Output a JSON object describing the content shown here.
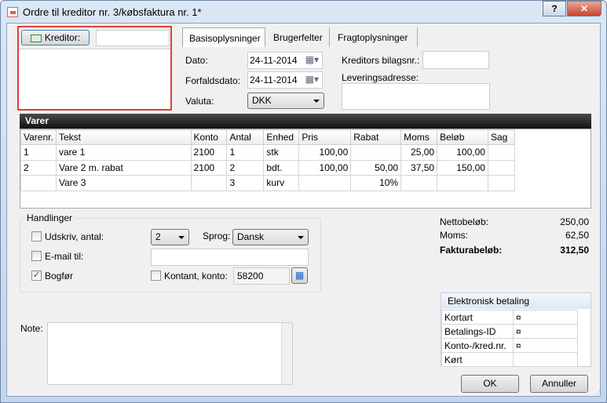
{
  "window": {
    "title": "Ordre til kreditor nr. 3/købsfaktura nr. 1*",
    "help": "?",
    "close": "✕"
  },
  "creditor": {
    "button": "Kreditor:",
    "value": ""
  },
  "tabs": [
    "Basisoplysninger",
    "Brugerfelter",
    "Fragtoplysninger"
  ],
  "basis": {
    "dato_label": "Dato:",
    "dato": "24-11-2014",
    "forfald_label": "Forfaldsdato:",
    "forfald": "24-11-2014",
    "valuta_label": "Valuta:",
    "valuta": "DKK",
    "bilag_label": "Kreditors bilagsnr.:",
    "bilag": "",
    "levering_label": "Leveringsadresse:",
    "levering": ""
  },
  "varer": {
    "title": "Varer",
    "columns": [
      "Varenr.",
      "Tekst",
      "Konto",
      "Antal",
      "Enhed",
      "Pris",
      "Rabat",
      "Moms",
      "Beløb",
      "Sag"
    ],
    "rows": [
      [
        "1",
        "vare 1",
        "2100",
        "1",
        "stk",
        "100,00",
        "",
        "25,00",
        "100,00",
        ""
      ],
      [
        "2",
        "Vare 2 m. rabat",
        "2100",
        "2",
        "bdt.",
        "100,00",
        "50,00",
        "37,50",
        "150,00",
        ""
      ],
      [
        "",
        "Vare 3",
        "",
        "3",
        "kurv",
        "",
        "10%",
        "",
        "",
        ""
      ]
    ]
  },
  "handlinger": {
    "title": "Handlinger",
    "udskriv": "Udskriv, antal:",
    "antal": "2",
    "sprog_label": "Sprog:",
    "sprog": "Dansk",
    "email": "E-mail til:",
    "email_value": "",
    "bogfor": "Bogfør",
    "bogfor_checked": true,
    "kontant": "Kontant, konto:",
    "konto": "58200"
  },
  "totals": {
    "netto_label": "Nettobeløb:",
    "netto": "250,00",
    "moms_label": "Moms:",
    "moms": "62,50",
    "faktura_label": "Fakturabeløb:",
    "faktura": "312,50"
  },
  "note": {
    "label": "Note:",
    "value": ""
  },
  "payment": {
    "title": "Elektronisk betaling",
    "rows": [
      [
        "Kortart",
        "¤"
      ],
      [
        "Betalings-ID",
        "¤"
      ],
      [
        "Konto-/kred.nr.",
        "¤"
      ],
      [
        "Kørt",
        ""
      ]
    ]
  },
  "buttons": {
    "ok": "OK",
    "cancel": "Annuller"
  }
}
